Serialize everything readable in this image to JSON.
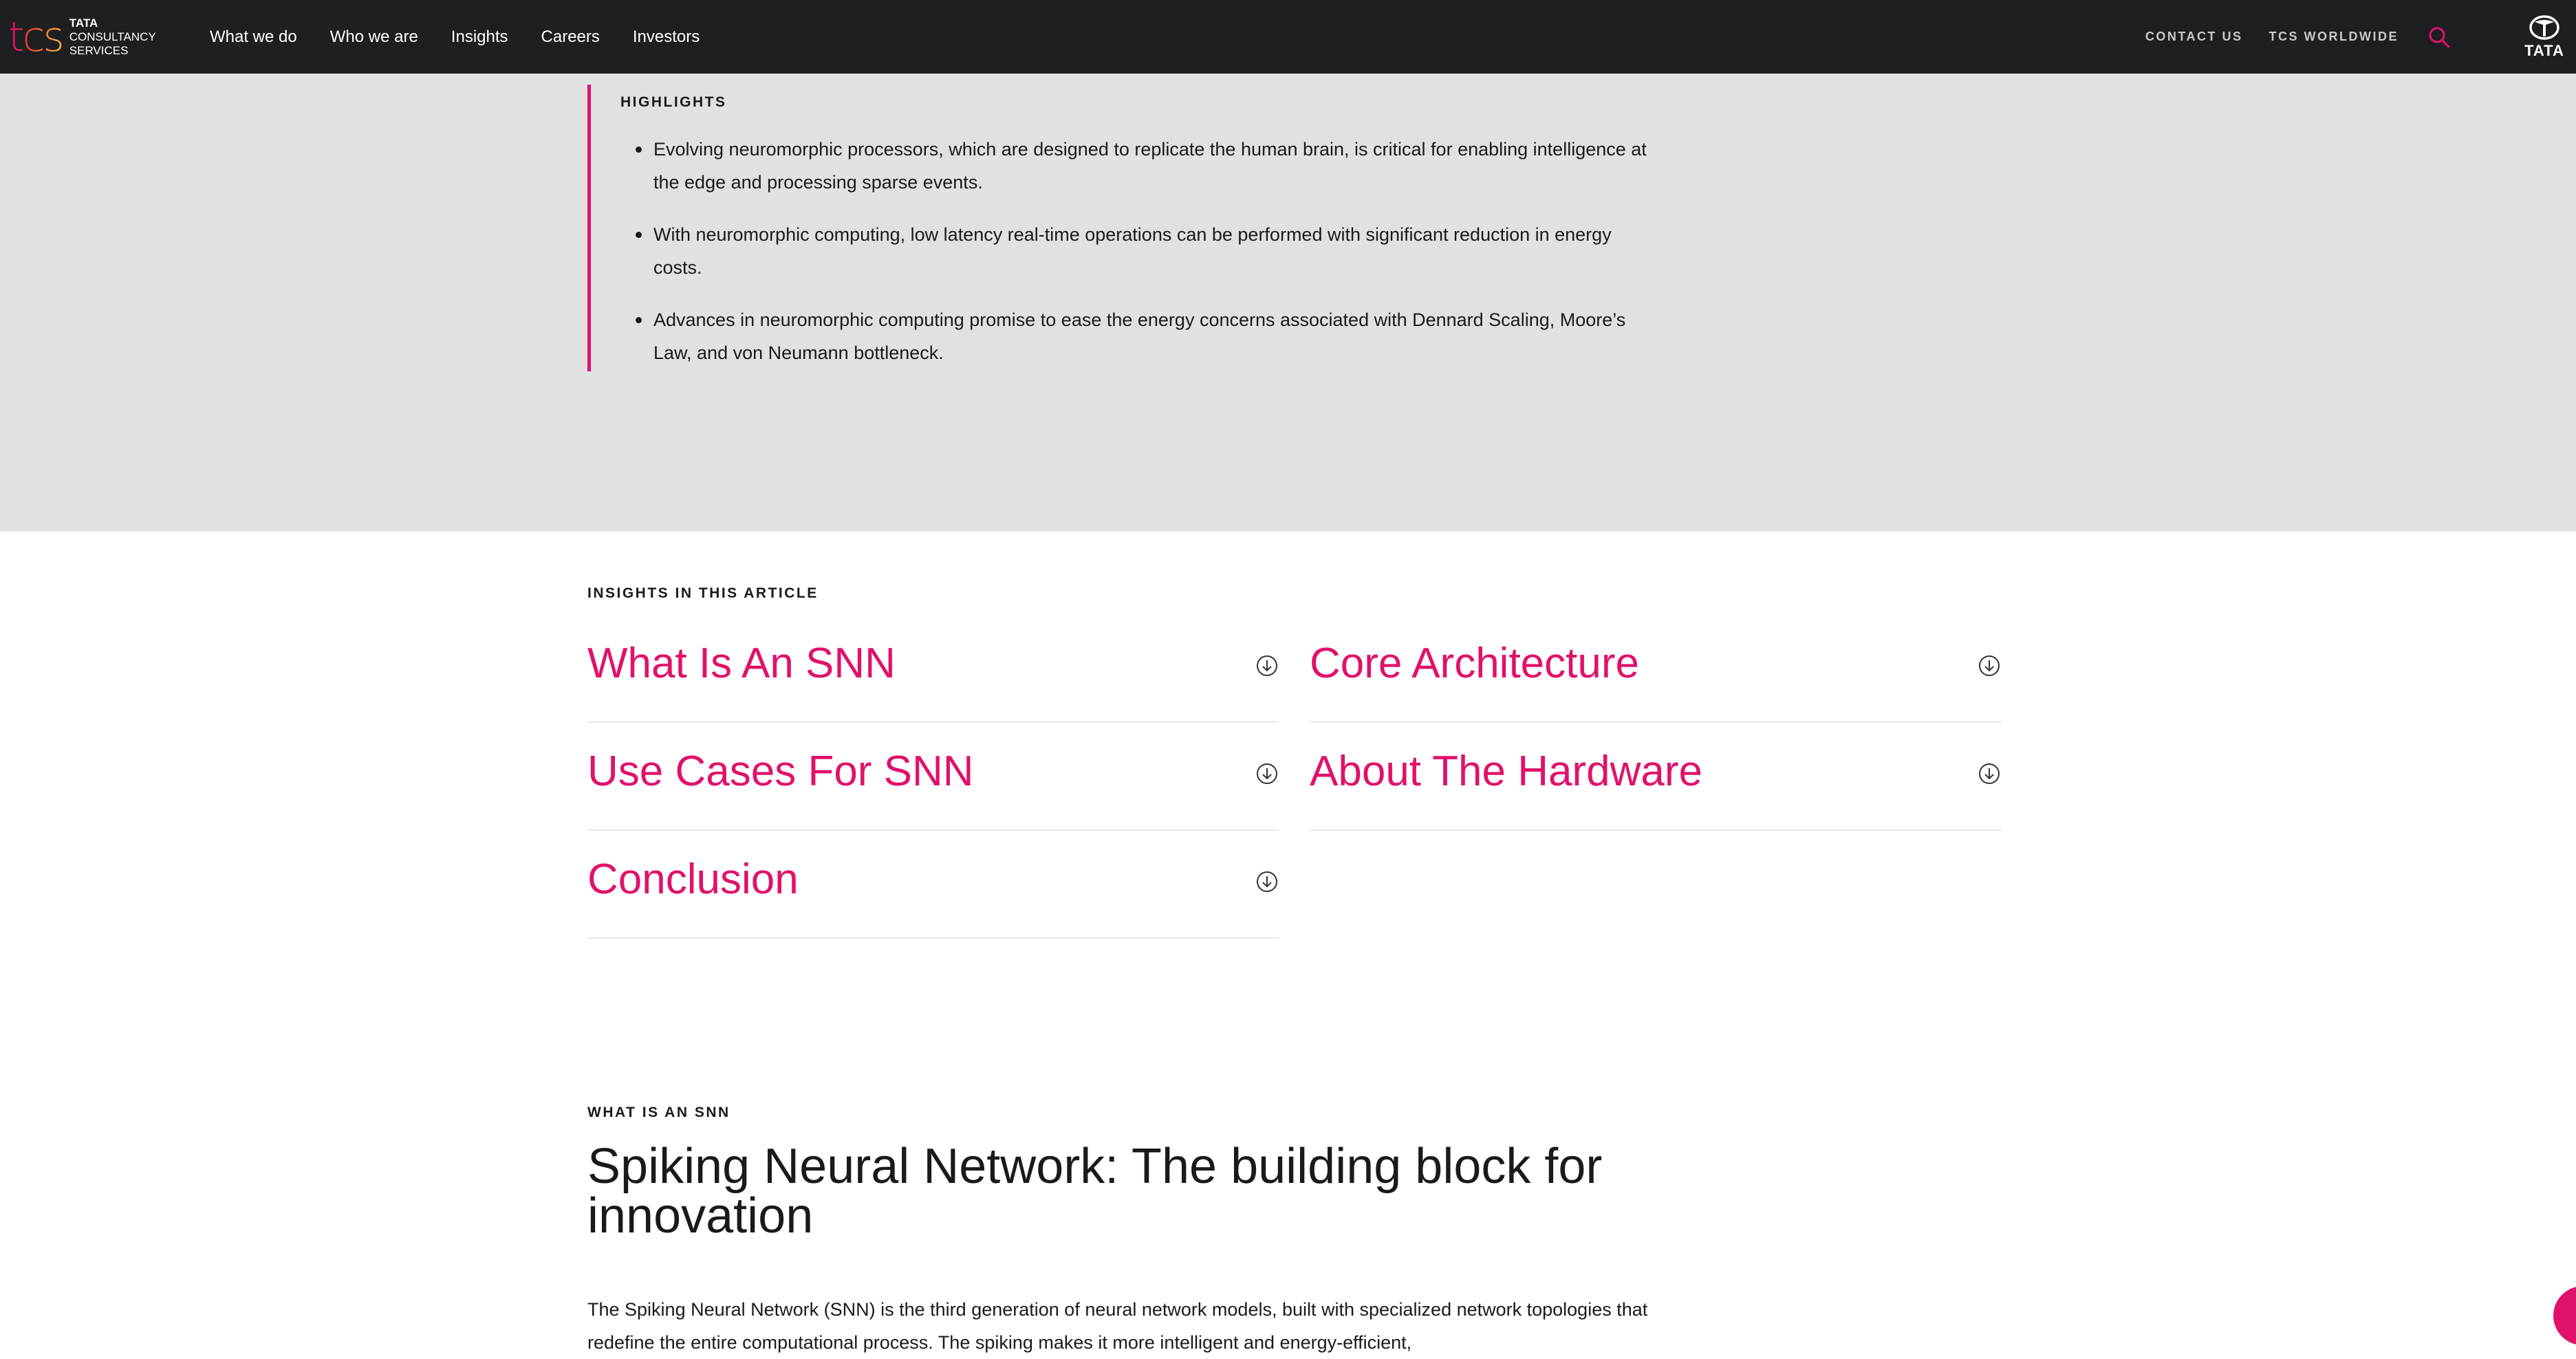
{
  "brand": {
    "logo_mark": "tcs",
    "logo_lines": [
      "TATA",
      "CONSULTANCY",
      "SERVICES"
    ],
    "tata_wordmark": "TATA",
    "accent_color": "#e0116b",
    "header_bg": "#1e1f22"
  },
  "nav": {
    "items": [
      {
        "label": "What we do"
      },
      {
        "label": "Who we are"
      },
      {
        "label": "Insights"
      },
      {
        "label": "Careers"
      },
      {
        "label": "Investors"
      }
    ]
  },
  "utility": {
    "contact": "CONTACT US",
    "worldwide": "TCS WORLDWIDE",
    "search_icon": "search-icon"
  },
  "highlights": {
    "title": "HIGHLIGHTS",
    "items": [
      "Evolving neuromorphic processors, which are designed to replicate the human brain, is critical for enabling intelligence at the edge and processing sparse events.",
      "With neuromorphic computing, low latency real-time operations can be performed with significant reduction in energy costs.",
      "Advances in neuromorphic computing promise to ease the energy concerns associated with Dennard Scaling, Moore’s Law, and von Neumann bottleneck."
    ]
  },
  "insights": {
    "label": "INSIGHTS IN THIS ARTICLE",
    "items": [
      {
        "title": "What Is An SNN"
      },
      {
        "title": "Core Architecture"
      },
      {
        "title": "Use Cases For SNN"
      },
      {
        "title": "About The Hardware"
      },
      {
        "title": "Conclusion"
      }
    ]
  },
  "section": {
    "label": "WHAT IS AN SNN",
    "heading": "Spiking Neural Network: The building block for innovation",
    "body": "The Spiking Neural Network (SNN) is the third generation of neural network models, built with specialized network topologies that redefine the entire computational process. The spiking makes it more intelligent and energy-efficient,"
  }
}
